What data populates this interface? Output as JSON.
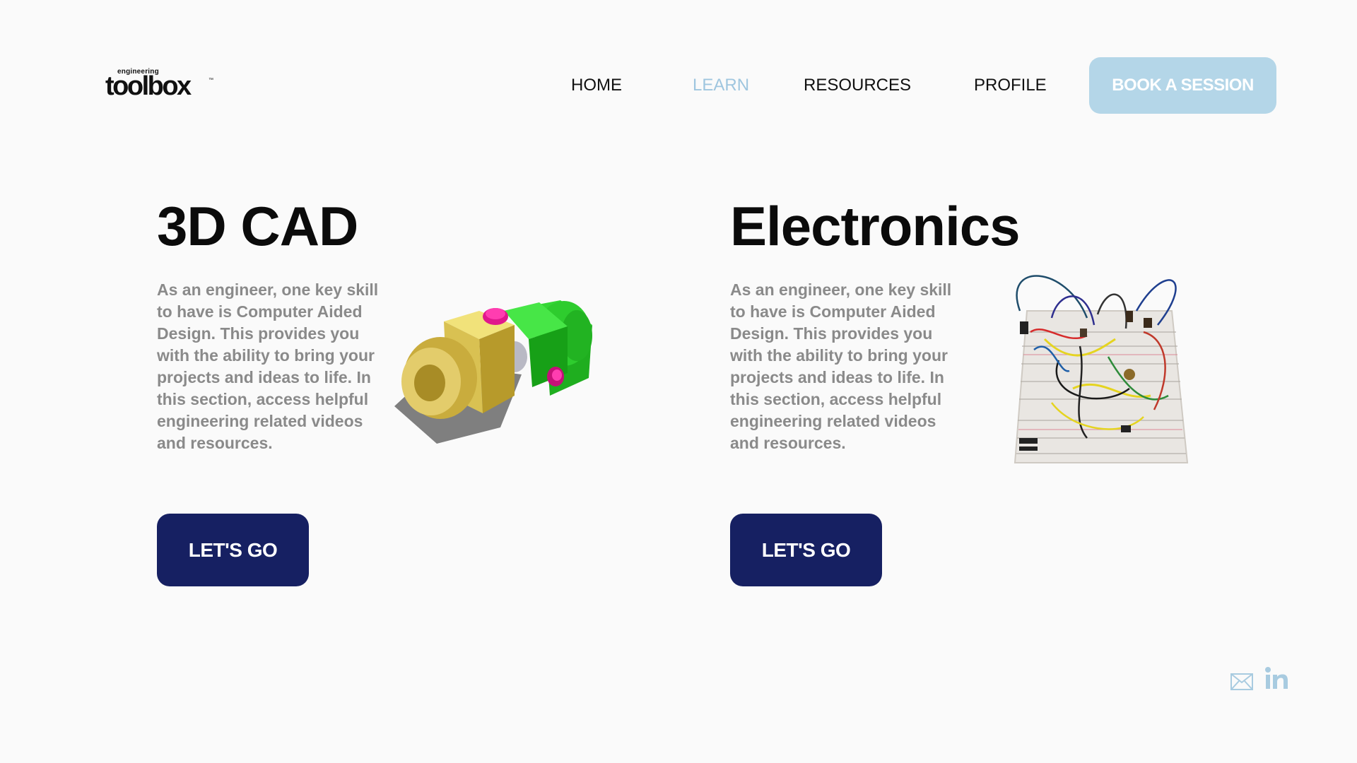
{
  "header": {
    "logo": {
      "small": "engineering",
      "main": "toolbox",
      "tm": "™"
    },
    "nav": [
      {
        "label": "HOME",
        "active": false
      },
      {
        "label": "LEARN",
        "active": true
      },
      {
        "label": "RESOURCES",
        "active": false
      },
      {
        "label": "PROFILE",
        "active": false
      }
    ],
    "book_label": "BOOK A SESSION"
  },
  "sections": [
    {
      "title": "3D CAD",
      "description": "As an engineer, one key skill to have is Computer Aided Design. This provides you with the ability to bring your projects and ideas to life. In this section, access helpful engineering related videos and resources.",
      "button_label": "LET'S GO",
      "illustration": "cad-universal-joint-image"
    },
    {
      "title": "Electronics",
      "description": "As an engineer, one key skill to have is Computer Aided Design. This provides you with the ability to bring your projects and ideas to life. In this section, access helpful engineering related videos and resources.",
      "button_label": "LET'S GO",
      "illustration": "breadboard-circuit-image"
    }
  ],
  "footer": {
    "icons": [
      "mail-icon",
      "linkedin-icon"
    ]
  },
  "colors": {
    "background": "#fafafa",
    "nav_active": "#9fc6df",
    "book_button": "#b4d6e8",
    "primary_button": "#162062",
    "description_text": "#8a8a8a"
  }
}
